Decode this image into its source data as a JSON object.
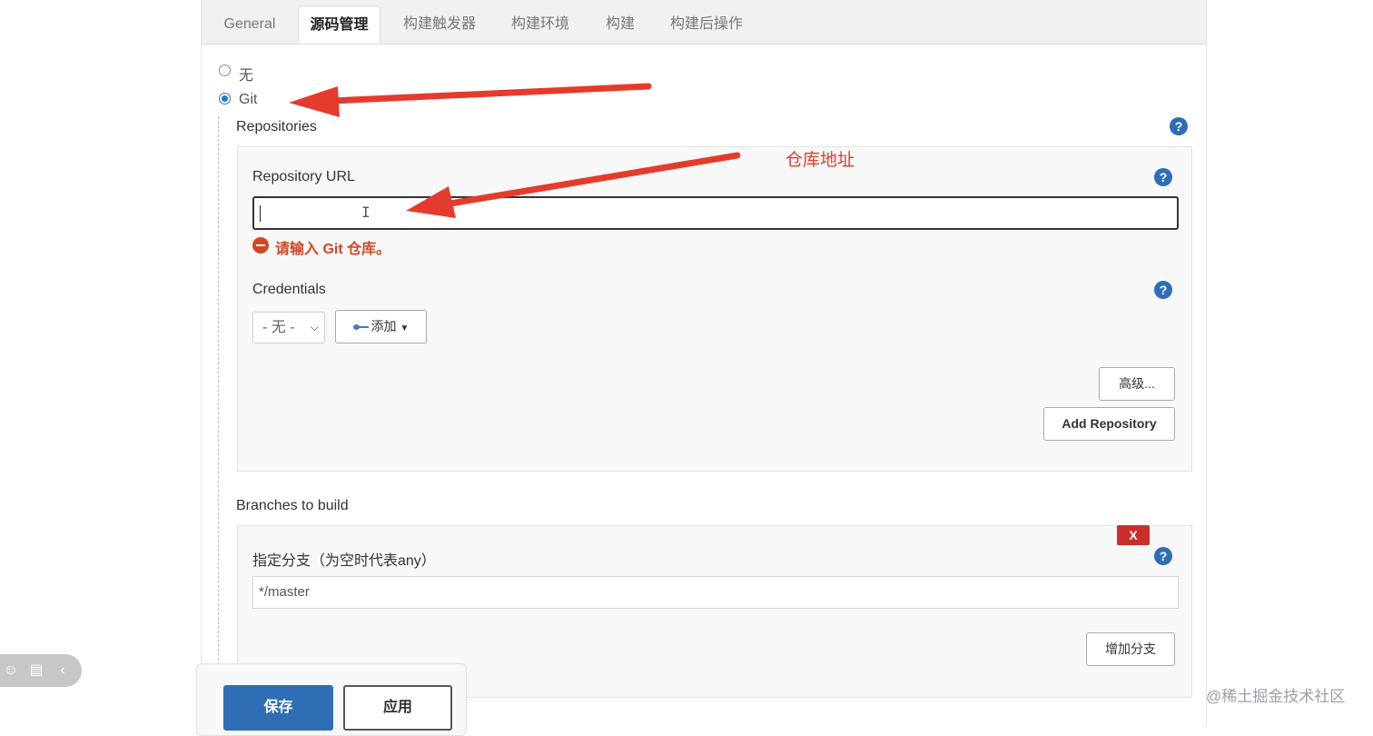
{
  "tabs": [
    {
      "label": "General"
    },
    {
      "label": "源码管理"
    },
    {
      "label": "构建触发器"
    },
    {
      "label": "构建环境"
    },
    {
      "label": "构建"
    },
    {
      "label": "构建后操作"
    }
  ],
  "scm": {
    "none_label": "无",
    "git_label": "Git",
    "selected": "Git"
  },
  "repositories": {
    "section_label": "Repositories",
    "url_label": "Repository URL",
    "url_value": "",
    "error_text": "请输入 Git 仓库。",
    "credentials_label": "Credentials",
    "credentials_selected": "- 无 -",
    "add_label": "添加",
    "advanced_label": "高级...",
    "add_repository_label": "Add Repository"
  },
  "branches": {
    "section_label": "Branches to build",
    "delete_label": "X",
    "spec_label": "指定分支（为空时代表any）",
    "spec_value": "*/master",
    "add_branch_label": "增加分支"
  },
  "footer": {
    "save_label": "保存",
    "apply_label": "应用"
  },
  "annotation": {
    "text": "仓库地址",
    "color": "#e53b2c"
  },
  "help_glyph": "?",
  "watermark": "@稀土掘金技术社区",
  "colors": {
    "accent": "#2f6eb5",
    "error": "#d24726",
    "delete": "#c9302c"
  }
}
